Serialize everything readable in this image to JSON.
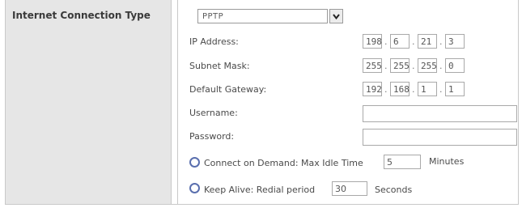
{
  "section": {
    "title": "Internet Connection Type"
  },
  "connection_type": {
    "selected": "PPTP"
  },
  "ip_address": {
    "label": "IP Address:",
    "octets": [
      "198",
      "6",
      "21",
      "3"
    ]
  },
  "subnet_mask": {
    "label": "Subnet Mask:",
    "octets": [
      "255",
      "255",
      "255",
      "0"
    ]
  },
  "default_gateway": {
    "label": "Default Gateway:",
    "octets": [
      "192",
      "168",
      "1",
      "1"
    ]
  },
  "username": {
    "label": "Username:",
    "value": ""
  },
  "password": {
    "label": "Password:",
    "value": ""
  },
  "connect_on_demand": {
    "label": "Connect on Demand: Max Idle Time",
    "value": "5",
    "unit": "Minutes"
  },
  "keep_alive": {
    "label": "Keep Alive: Redial period",
    "value": "30",
    "unit": "Seconds"
  },
  "colors": {
    "left_panel": "#e6e6e6",
    "border": "#c9c9c9",
    "radio": "#5a6fae"
  },
  "icons": {
    "dropdown": "chevron-down-icon"
  }
}
